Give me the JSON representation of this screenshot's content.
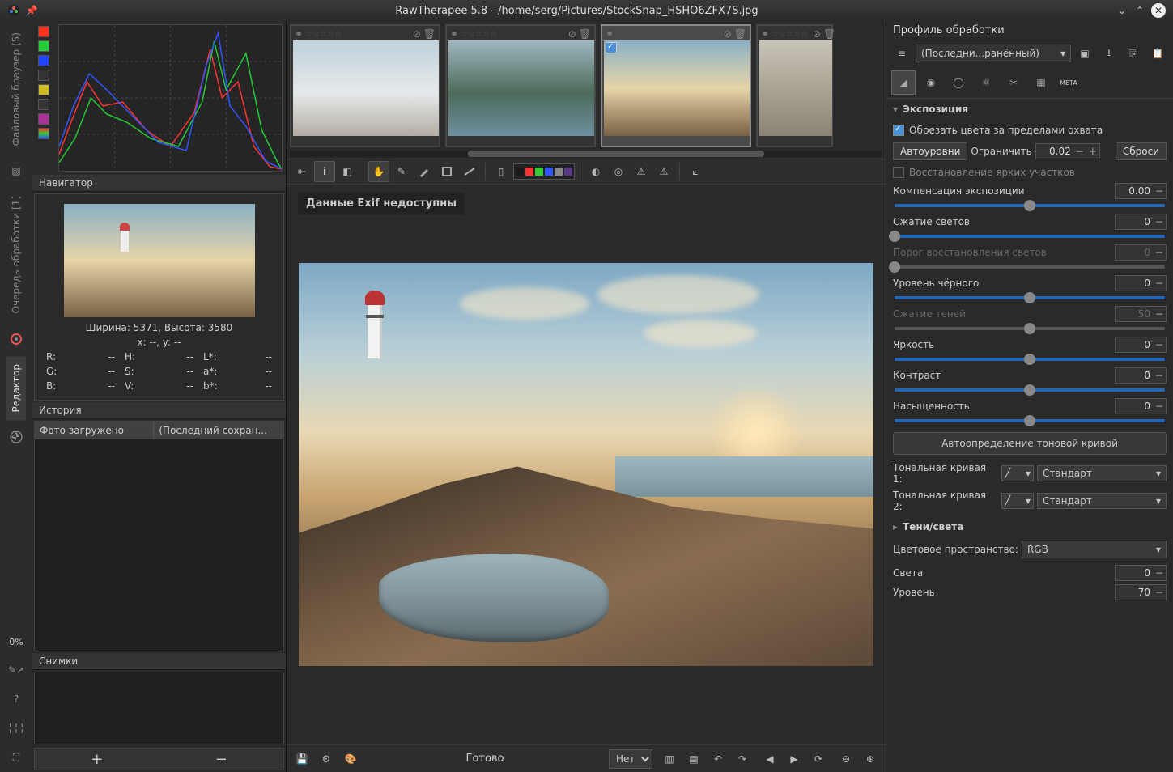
{
  "window": {
    "title": "RawTherapee 5.8 - /home/serg/Pictures/StockSnap_HSHO6ZFX7S.jpg"
  },
  "sidebar": {
    "tabs": {
      "browser": "Файловый браузер (5)",
      "queue": "Очередь обработки [1]",
      "editor": "Редактор"
    },
    "zoom_pct": "0%"
  },
  "histogram": {
    "swatches": [
      "#ff3322",
      "#22cc33",
      "#2244ff",
      "#333333",
      "#ccbb22",
      "#333333",
      "#aa3399"
    ]
  },
  "navigator": {
    "title": "Навигатор",
    "dimensions": "Ширина: 5371, Высота: 3580",
    "coords": "x: --, y: --",
    "readouts": [
      {
        "k": "R:",
        "v": "--"
      },
      {
        "k": "H:",
        "v": "--"
      },
      {
        "k": "L*:",
        "v": "--"
      },
      {
        "k": "G:",
        "v": "--"
      },
      {
        "k": "S:",
        "v": "--"
      },
      {
        "k": "a*:",
        "v": "--"
      },
      {
        "k": "B:",
        "v": "--"
      },
      {
        "k": "V:",
        "v": "--"
      },
      {
        "k": "b*:",
        "v": "--"
      }
    ]
  },
  "history": {
    "title": "История",
    "rows": [
      {
        "event": "Фото загружено",
        "profile": "(Последний сохран..."
      }
    ]
  },
  "snapshots": {
    "title": "Снимки"
  },
  "filmstrip": {
    "thumbs": [
      {
        "selected": false,
        "checked": false,
        "narrow": false
      },
      {
        "selected": false,
        "checked": false,
        "narrow": false
      },
      {
        "selected": true,
        "checked": true,
        "narrow": false
      },
      {
        "selected": false,
        "checked": false,
        "narrow": true
      }
    ]
  },
  "toolbar_swatches": [
    "#1a1a1a",
    "#ff3333",
    "#33cc33",
    "#3355ff",
    "#888888",
    "#5a3a88"
  ],
  "viewport": {
    "exif_notice": "Данные Exif недоступны"
  },
  "bottombar": {
    "status": "Готово",
    "template_dropdown": "Нет"
  },
  "right": {
    "profile_header": "Профиль обработки",
    "profile_combo": "(Последни...ранённый)",
    "exposure": {
      "title": "Экспозиция",
      "clip_label": "Обрезать цвета за пределами охвата",
      "auto_label": "Автоуровни",
      "limit_label": "Ограничить",
      "limit_value": "0.02",
      "reset_label": "Сброси",
      "recover_label": "Восстановление ярких участков",
      "sliders": [
        {
          "label": "Компенсация экспозиции",
          "value": "0.00",
          "pos": 50,
          "disabled": false
        },
        {
          "label": "Сжатие светов",
          "value": "0",
          "pos": 0,
          "disabled": false
        },
        {
          "label": "Порог восстановления светов",
          "value": "0",
          "pos": 0,
          "disabled": true
        },
        {
          "label": "Уровень чёрного",
          "value": "0",
          "pos": 50,
          "disabled": false
        },
        {
          "label": "Сжатие теней",
          "value": "50",
          "pos": 50,
          "disabled": true
        },
        {
          "label": "Яркость",
          "value": "0",
          "pos": 50,
          "disabled": false
        },
        {
          "label": "Контраст",
          "value": "0",
          "pos": 50,
          "disabled": false
        },
        {
          "label": "Насыщенность",
          "value": "0",
          "pos": 50,
          "disabled": false
        }
      ],
      "auto_curve": "Автоопределение тоновой кривой",
      "curve1_label": "Тональная кривая 1:",
      "curve2_label": "Тональная кривая 2:",
      "curve_mode": "Стандарт"
    },
    "shadows": {
      "title": "Тени/света",
      "colorspace_label": "Цветовое пространство:",
      "colorspace_value": "RGB",
      "lights_label": "Света",
      "lights_value": "0",
      "level_label": "Уровень",
      "level_value": "70"
    }
  }
}
